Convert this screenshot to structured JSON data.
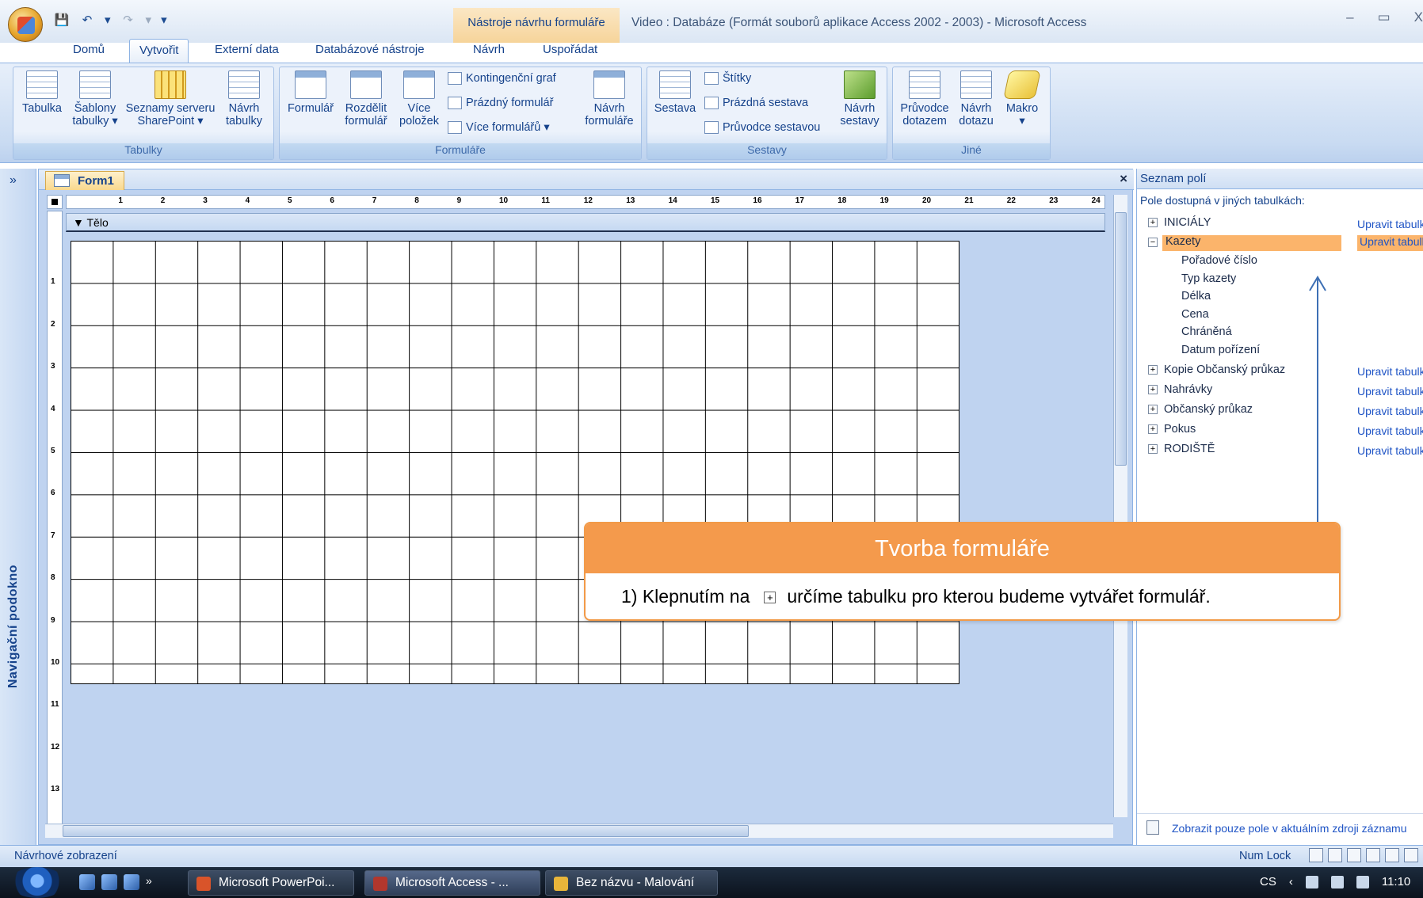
{
  "window": {
    "title": "Video : Databáze (Formát souborů aplikace Access 2002 - 2003) - Microsoft Access",
    "context_tools": "Nástroje návrhu formuláře",
    "controls": {
      "minimize": "–",
      "restore": "▭",
      "close": "X"
    }
  },
  "quick_access": {
    "save": "💾",
    "undo": "↶",
    "undo_dd": "▾",
    "redo": "↷",
    "redo_dd": "▾",
    "customize": "▾"
  },
  "tabs": [
    "Domů",
    "Vytvořit",
    "Externí data",
    "Databázové nástroje",
    "Návrh",
    "Uspořádat"
  ],
  "active_tab": "Vytvořit",
  "ribbon": {
    "groups": {
      "tables": "Tabulky",
      "forms": "Formuláře",
      "reports": "Sestavy",
      "other": "Jiné"
    },
    "tables": {
      "tabulka": "Tabulka",
      "sablony": [
        "Šablony",
        "tabulky ▾"
      ],
      "seznamy": [
        "Seznamy serveru",
        "SharePoint ▾"
      ],
      "navrh_tabulky": [
        "Návrh",
        "tabulky"
      ]
    },
    "forms": {
      "formular": "Formulář",
      "rozdelit": [
        "Rozdělit",
        "formulář"
      ],
      "vice_polozek": [
        "Více",
        "položek"
      ],
      "kontingencni_graf": "Kontingenční graf",
      "prazdny_formular": "Prázdný formulář",
      "vice_formularu": "Více formulářů ▾",
      "navrh_formulare": [
        "Návrh",
        "formuláře"
      ]
    },
    "reports": {
      "sestava": "Sestava",
      "stitky": "Štítky",
      "prazdna_sestava": "Prázdná sestava",
      "pruvodce_sestavou": "Průvodce sestavou",
      "navrh_sestavy": [
        "Návrh",
        "sestavy"
      ]
    },
    "other": {
      "pruvodce_dotazem": [
        "Průvodce",
        "dotazem"
      ],
      "navrh_dotazu": [
        "Návrh",
        "dotazu"
      ],
      "makro": [
        "Makro",
        "▾"
      ]
    }
  },
  "nav_pane": {
    "label": "Navigační podokno",
    "toggle": "»"
  },
  "document": {
    "tab_label": "Form1",
    "close": "×",
    "section_label": "Tělo",
    "ruler_h": [
      "1",
      "2",
      "3",
      "4",
      "5",
      "6",
      "7",
      "8",
      "9",
      "10",
      "11",
      "12",
      "13",
      "14",
      "15",
      "16",
      "17",
      "18",
      "19",
      "20",
      "21",
      "22",
      "23",
      "24"
    ],
    "ruler_v": [
      "1",
      "2",
      "3",
      "4",
      "5",
      "6",
      "7",
      "8",
      "9",
      "10",
      "11",
      "12",
      "13"
    ]
  },
  "field_list": {
    "title": "Seznam polí",
    "close": "×",
    "subtitle": "Pole dostupná v jiných tabulkách:",
    "edit_label": "Upravit tabulku",
    "tables": [
      {
        "name": "INICIÁLY",
        "expanded": false
      },
      {
        "name": "Kazety",
        "expanded": true
      },
      {
        "name": "Kopie Občanský průkaz",
        "expanded": false
      },
      {
        "name": "Nahrávky",
        "expanded": false
      },
      {
        "name": "Občanský průkaz",
        "expanded": false
      },
      {
        "name": "Pokus",
        "expanded": false
      },
      {
        "name": "RODIŠTĚ",
        "expanded": false
      }
    ],
    "kazety_fields": [
      "Pořadové číslo",
      "Typ kazety",
      "Délka",
      "Cena",
      "Chráněná",
      "Datum pořízení"
    ],
    "footer": "Zobrazit pouze pole v aktuálním zdroji záznamu"
  },
  "callout": {
    "title": "Tvorba formuláře",
    "body_before": "1) Klepnutím na",
    "body_after": "určíme tabulku pro  kterou budeme vytvářet formulář."
  },
  "statusbar": {
    "left": "Návrhové zobrazení",
    "numlock": "Num Lock"
  },
  "taskbar": {
    "quicklaunch_more": "»",
    "tasks": [
      "Microsoft PowerPoi...",
      "Microsoft Access - ...",
      "Bez názvu - Malování"
    ],
    "language": "CS",
    "tray_arrow": "‹",
    "clock": "11:10"
  },
  "colors": {
    "accent_orange": "#f49a4c",
    "ribbon_blue": "#c9dbf2",
    "text_blue": "#15428b"
  }
}
